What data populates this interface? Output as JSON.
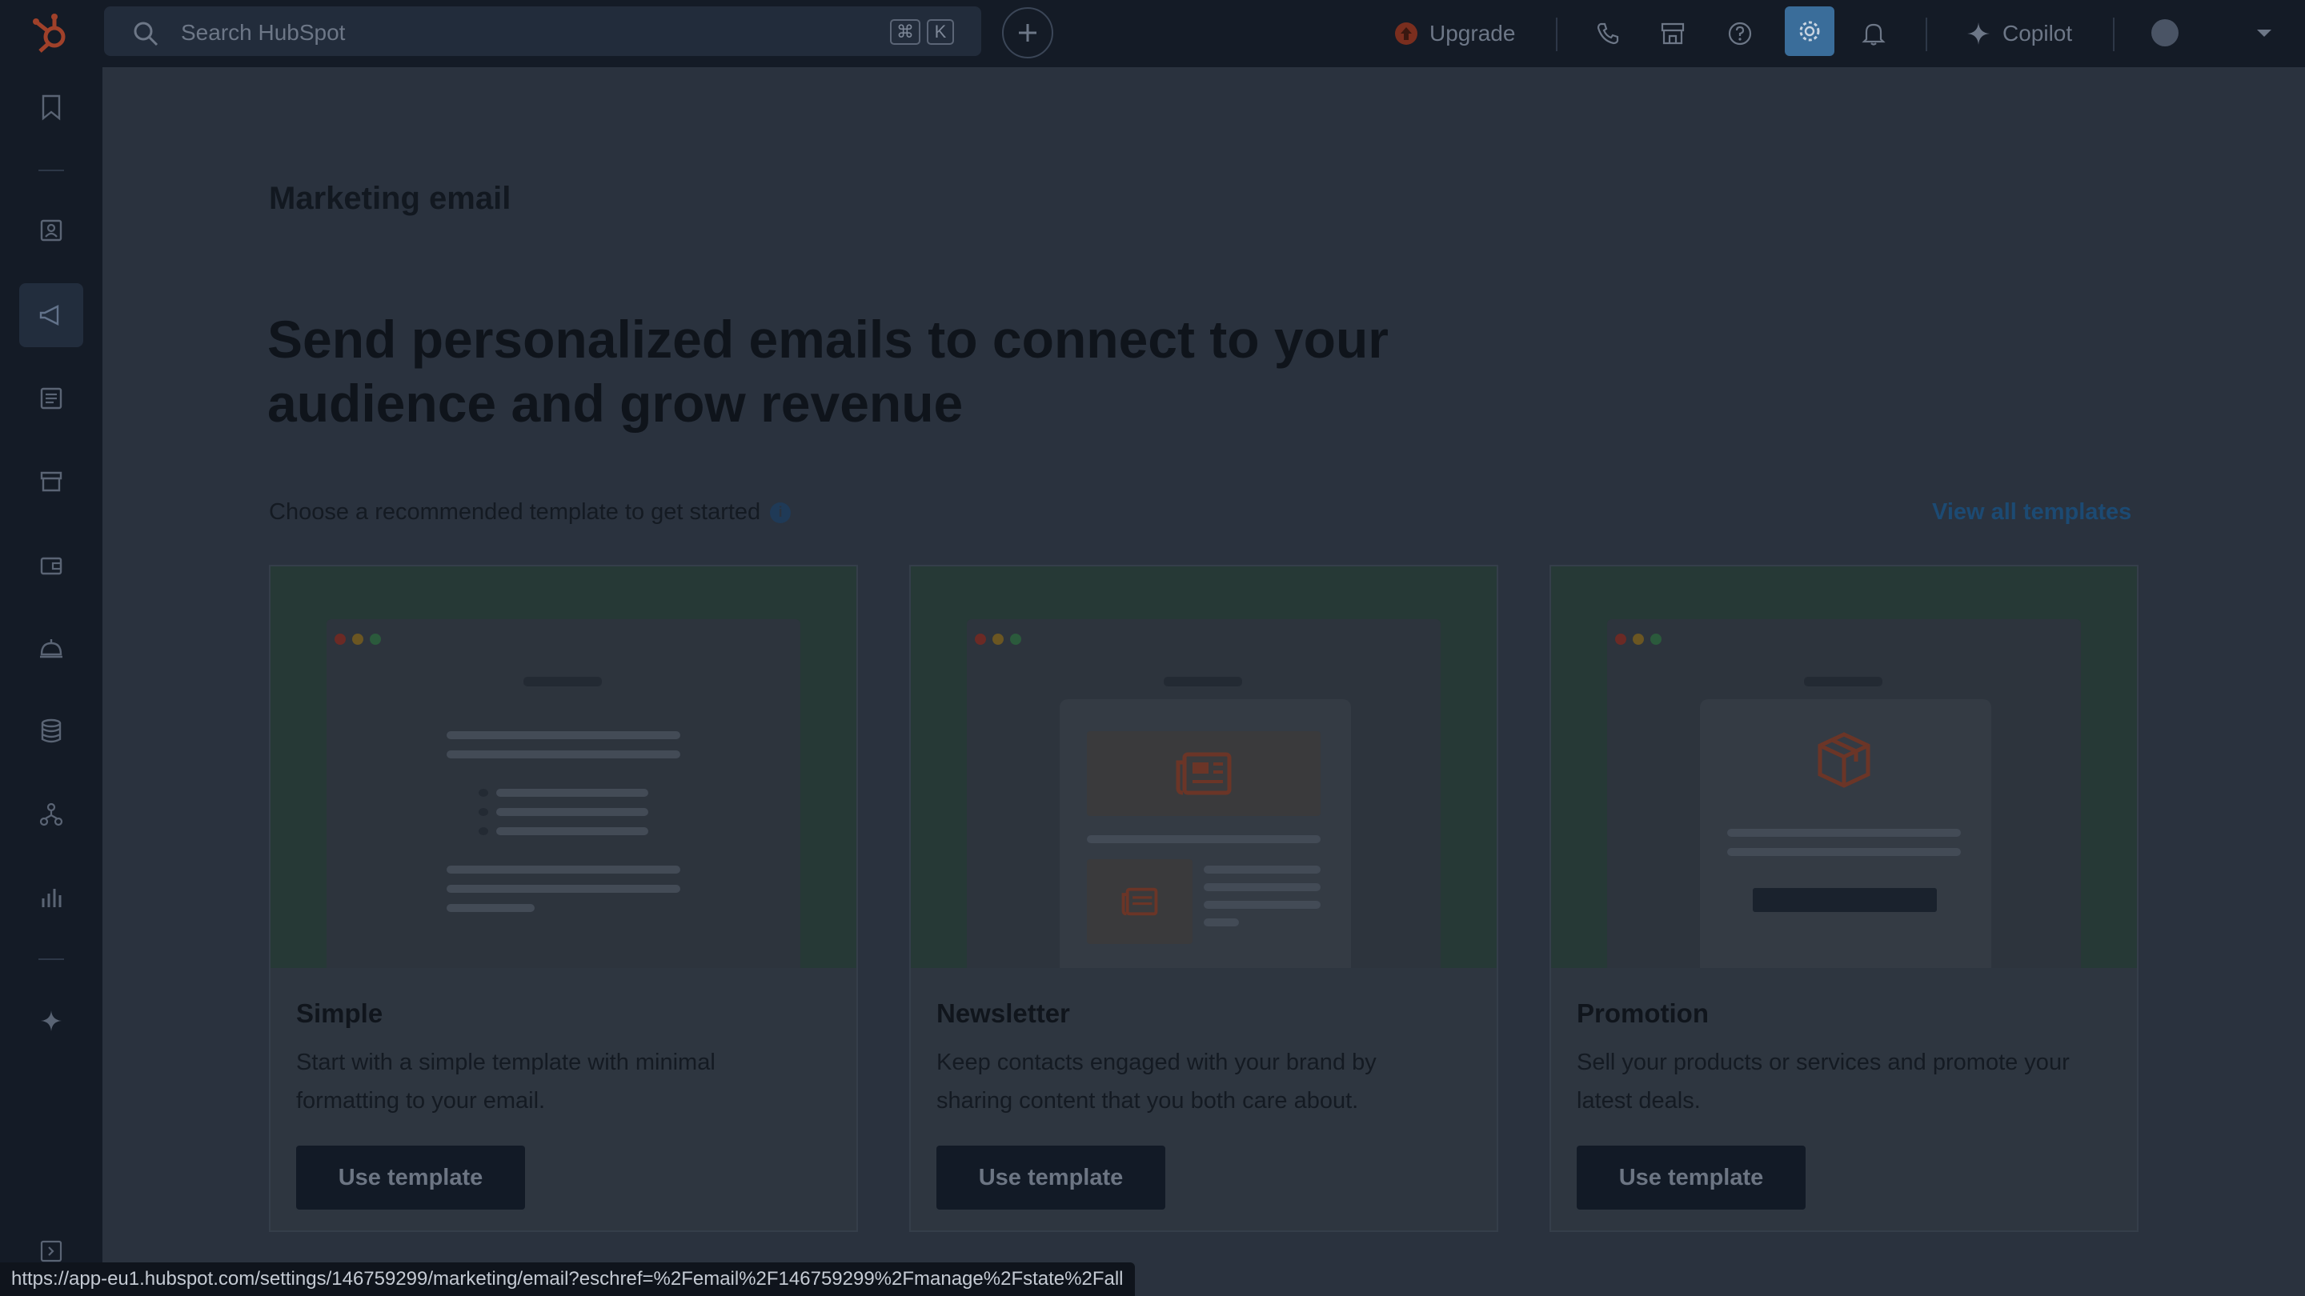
{
  "topbar": {
    "search_placeholder": "Search HubSpot",
    "shortcut_cmd": "⌘",
    "shortcut_key": "K",
    "upgrade_label": "Upgrade",
    "copilot_label": "Copilot"
  },
  "page": {
    "title": "Marketing email",
    "hero": "Send personalized emails to connect to your audience and grow revenue",
    "subtitle": "Choose a recommended template to get started",
    "info_glyph": "i",
    "view_all": "View all templates"
  },
  "templates": [
    {
      "title": "Simple",
      "description": "Start with a simple template with minimal formatting to your email.",
      "button": "Use template"
    },
    {
      "title": "Newsletter",
      "description": "Keep contacts engaged with your brand by sharing content that you both care about.",
      "button": "Use template"
    },
    {
      "title": "Promotion",
      "description": "Sell your products or services and promote your latest deals.",
      "button": "Use template"
    }
  ],
  "status_url": "https://app-eu1.hubspot.com/settings/146759299/marketing/email?eschref=%2Femail%2F146759299%2Fmanage%2Fstate%2Fall",
  "colors": {
    "brand": "#ff7a59",
    "accent": "#3a6d9a",
    "overlay_bg": "#2a323e"
  }
}
